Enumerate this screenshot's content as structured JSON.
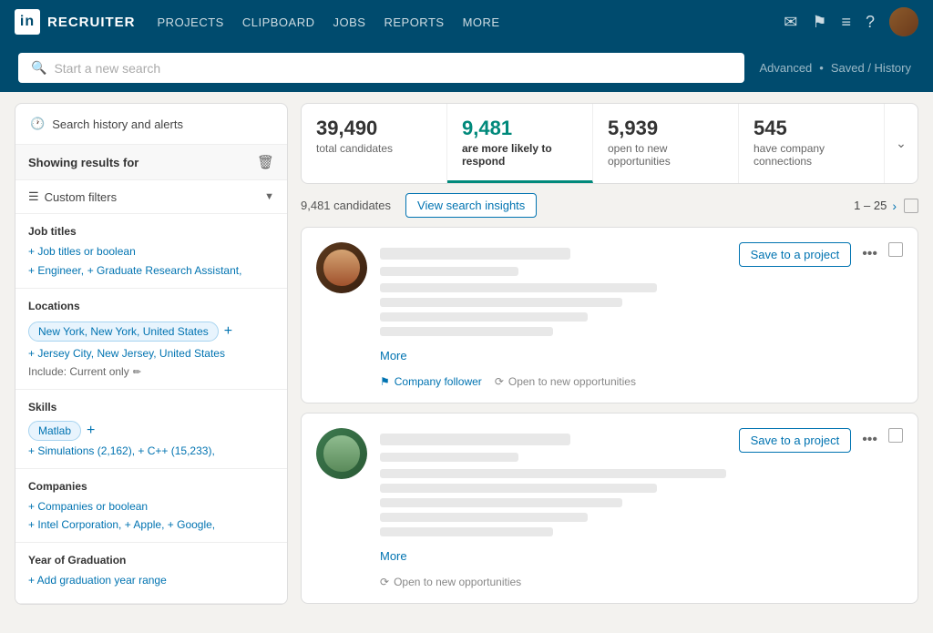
{
  "navbar": {
    "brand": "RECRUITER",
    "logo": "in",
    "links": [
      "PROJECTS",
      "CLIPBOARD",
      "JOBS",
      "REPORTS",
      "MORE"
    ]
  },
  "searchbar": {
    "placeholder": "Start a new search",
    "advanced_label": "Advanced",
    "saved_history_label": "Saved / History"
  },
  "sidebar": {
    "history_label": "Search history and alerts",
    "showing_results_label": "Showing results for",
    "filters_label": "Custom filters",
    "sections": {
      "job_titles": {
        "title": "Job titles",
        "add_label": "+ Job titles or boolean",
        "tags": [
          "+ Engineer,",
          "+ Graduate Research Assistant,"
        ]
      },
      "locations": {
        "title": "Locations",
        "primary_location": "New York, New York, United States",
        "secondary_location": "+ Jersey City, New Jersey, United States",
        "include_label": "Include: Current only"
      },
      "skills": {
        "title": "Skills",
        "primary_skill": "Matlab",
        "other_skills": "+ Simulations (2,162), + C++ (15,233),"
      },
      "companies": {
        "title": "Companies",
        "add_label": "+ Companies or boolean",
        "tags": "+ Intel Corporation, + Apple, + Google,"
      },
      "graduation": {
        "title": "Year of Graduation",
        "add_label": "+ Add graduation year range"
      }
    }
  },
  "stats": {
    "total": {
      "number": "39,490",
      "label": "total candidates"
    },
    "likely": {
      "number": "9,481",
      "label": "are more likely to respond"
    },
    "open": {
      "number": "5,939",
      "label": "open to new opportunities"
    },
    "connected": {
      "number": "545",
      "label": "have company connections"
    }
  },
  "results": {
    "candidates_count": "9,481 candidates",
    "view_insights_label": "View search insights",
    "pagination": "1 – 25",
    "candidates": [
      {
        "id": 1,
        "badges": [
          "Company follower",
          "Open to new opportunities"
        ],
        "save_label": "Save to a project",
        "more_label": "More"
      },
      {
        "id": 2,
        "badges": [
          "Open to new opportunities"
        ],
        "save_label": "Save to a project",
        "more_label": "More"
      }
    ]
  }
}
